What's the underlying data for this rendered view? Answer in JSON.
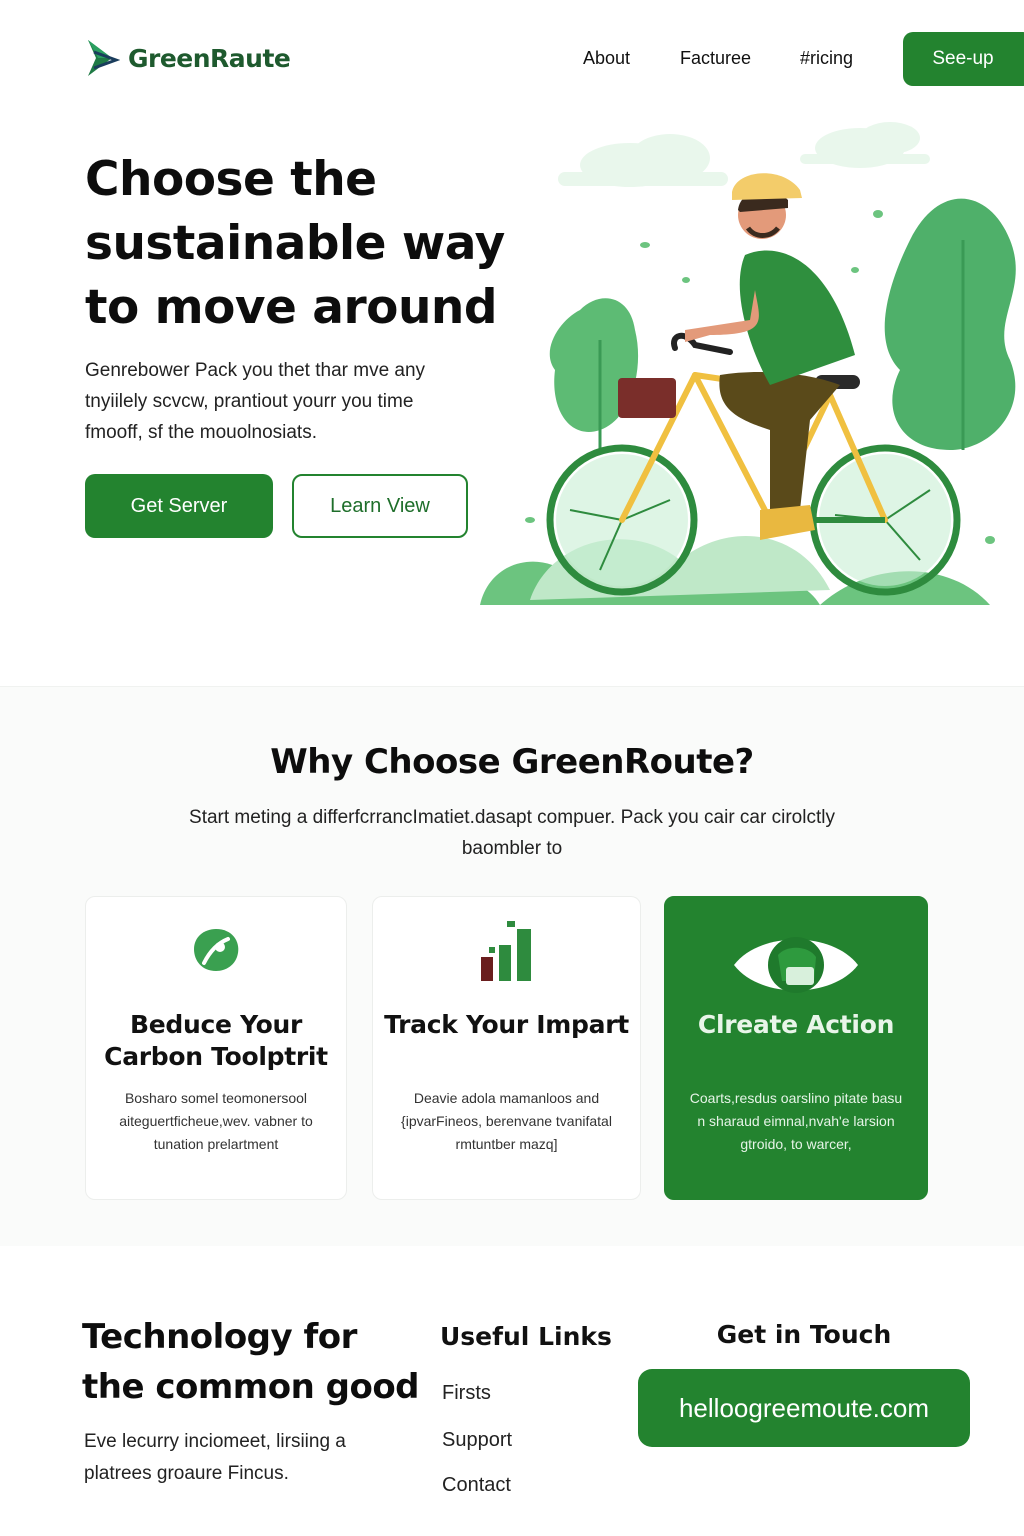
{
  "header": {
    "brand": "GreenRaute",
    "nav": [
      "About",
      "Facturee",
      "#ricing"
    ],
    "signup_label": "See-up"
  },
  "hero": {
    "title": "Choose the sustainable  way to move around",
    "subtitle": "Genrebower Pack you thet thar mve any tnyiilely scvcw, prantiout yourr you time fmooff, sf the mouolnosiats.",
    "primary_button": "Get Server",
    "secondary_button": "Learn View"
  },
  "why": {
    "title": "Why Choose GreenRoute?",
    "subtitle": "Start meting a differfcrrancImatiet.dasapt compuer. Pack you cair car cirolctly baombler to",
    "cards": [
      {
        "icon": "leaf-icon",
        "title": "Beduce Your Carbon Toolptrit",
        "text": "Bosharo somel teomonersool aiteguertficheue,wev. vabner to tunation prelartment"
      },
      {
        "icon": "bar-chart-icon",
        "title": "Track Your Impart",
        "text": "Deavie adola mamanloos and {ipvarFineos, berenvane tvanifatal rmtuntber mazq]"
      },
      {
        "icon": "eye-icon",
        "title": "Clreate Action",
        "text": "Coarts,resdus oarslino pitate basu n sharaud eimnal,nvah'e larsion gtroido, to warcer,"
      }
    ]
  },
  "footer": {
    "title": "Technology for the common good",
    "text": "Eve lecurry inciomeet, lirsiing a platrees groaure Fincus.",
    "links_title": "Useful Links",
    "links": [
      "Firsts",
      "Support",
      "Contact"
    ],
    "contact_title": "Get in Touch",
    "email": "helloogreemoute.com"
  },
  "colors": {
    "brand_green": "#23832f",
    "light_green": "#8fd6a0",
    "dark_green_text": "#1e5a2e"
  }
}
